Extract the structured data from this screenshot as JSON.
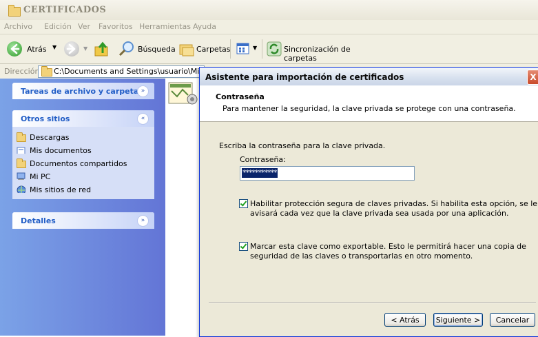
{
  "window": {
    "title": "CERTIFICADOS",
    "menu": [
      "Archivo",
      "Edición",
      "Ver",
      "Favoritos",
      "Herramientas",
      "Ayuda"
    ],
    "toolbar": {
      "back_label": "Atrás",
      "search_label": "Búsqueda",
      "folders_label": "Carpetas",
      "sync_label": "Sincronización de carpetas"
    },
    "address": {
      "label": "Dirección",
      "value": "C:\\Documents and Settings\\usuario\\Mis docum"
    }
  },
  "taskpane": {
    "file_tasks": {
      "title": "Tareas de archivo y carpeta"
    },
    "other_places": {
      "title": "Otros sitios",
      "items": [
        {
          "label": "Descargas",
          "icon": "folder-icon"
        },
        {
          "label": "Mis documentos",
          "icon": "documents-icon"
        },
        {
          "label": "Documentos compartidos",
          "icon": "folder-icon"
        },
        {
          "label": "Mi PC",
          "icon": "computer-icon"
        },
        {
          "label": "Mis sitios de red",
          "icon": "network-icon"
        }
      ]
    },
    "details": {
      "title": "Detalles"
    }
  },
  "dialog": {
    "title": "Asistente para importación de certificados",
    "header_title": "Contraseña",
    "header_subtitle": "Para mantener la seguridad, la clave privada se protege con una contraseña.",
    "instruction": "Escriba la contraseña para la clave privada.",
    "password_label": "Contraseña:",
    "password_value": "***********",
    "option1_line1": "Habilitar protección segura de claves privadas. Si habilita esta opción, se le",
    "option1_line2": "avisará cada vez que la clave privada sea usada por una aplicación.",
    "option1_checked": true,
    "option2_line1": "Marcar esta clave como exportable. Esto le permitirá hacer una copia de",
    "option2_line2": "seguridad de las claves o transportarlas en otro momento.",
    "option2_checked": true,
    "buttons": {
      "back": "< Atrás",
      "next": "Siguiente >",
      "cancel": "Cancelar"
    },
    "close_glyph": "X"
  }
}
